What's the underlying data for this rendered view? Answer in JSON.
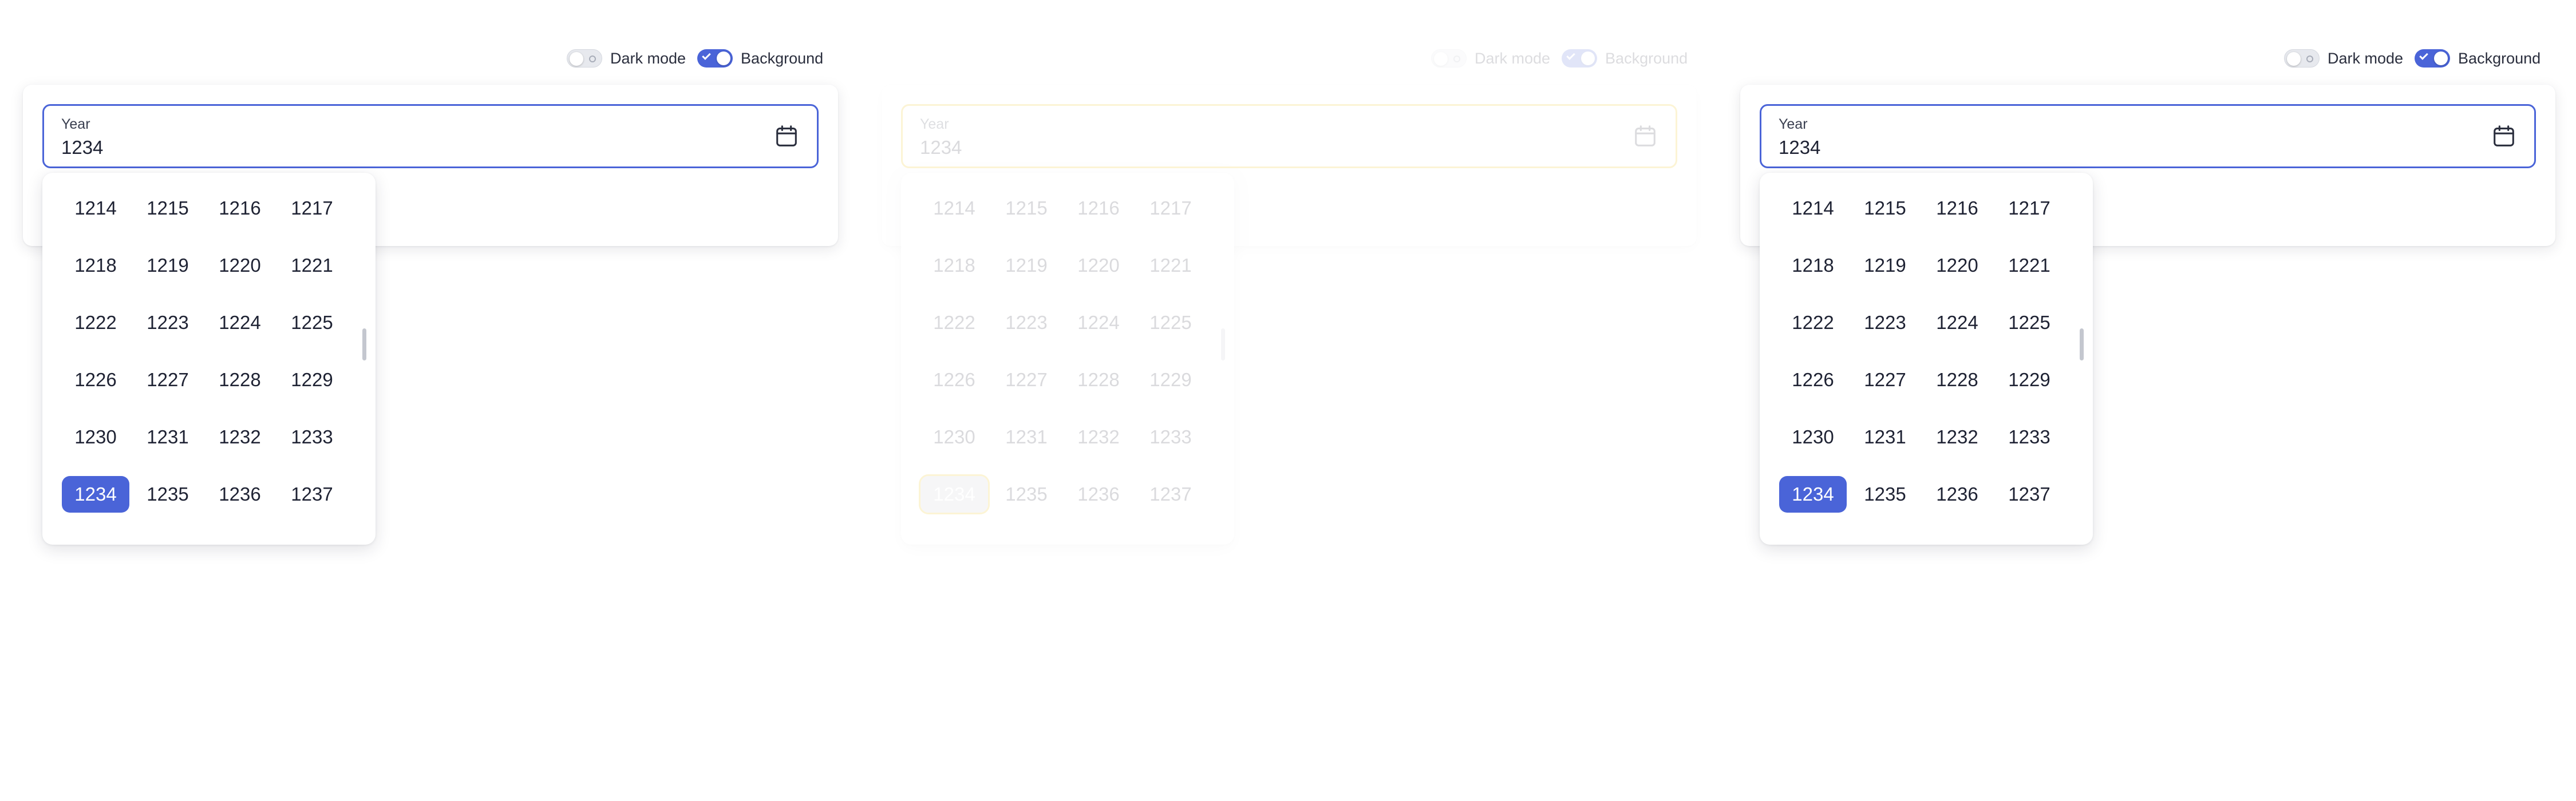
{
  "toggles": {
    "dark_mode_label": "Dark mode",
    "background_label": "Background"
  },
  "field": {
    "label": "Year",
    "value": "1234"
  },
  "years": [
    "1214",
    "1215",
    "1216",
    "1217",
    "1218",
    "1219",
    "1220",
    "1221",
    "1222",
    "1223",
    "1224",
    "1225",
    "1226",
    "1227",
    "1228",
    "1229",
    "1230",
    "1231",
    "1232",
    "1233",
    "1234",
    "1235",
    "1236",
    "1237"
  ],
  "selected_year": "1234",
  "colors": {
    "accent": "#4a64d8",
    "focus_ring": "#f2c200"
  },
  "icons": {
    "calendar": "calendar-icon",
    "check": "check-icon"
  }
}
